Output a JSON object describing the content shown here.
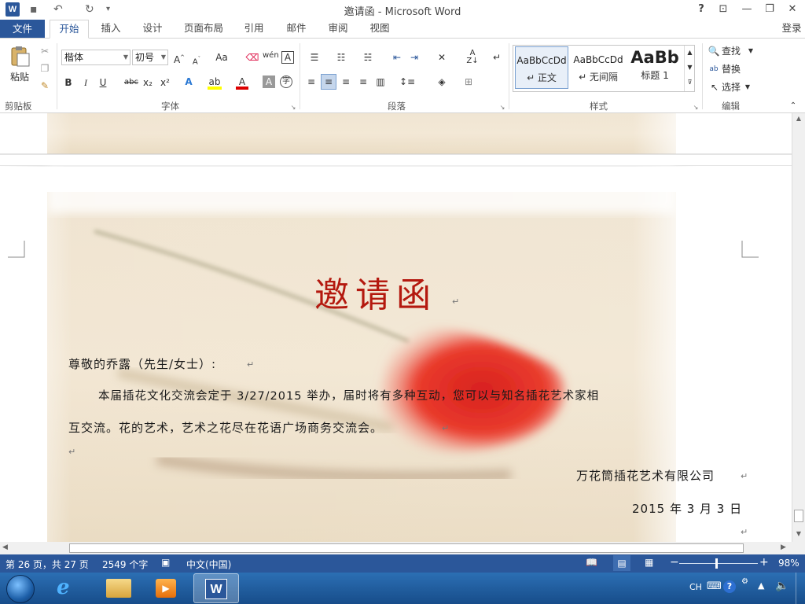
{
  "window": {
    "title": "邀请函 - Microsoft Word",
    "help": "?",
    "controls": [
      "⊡",
      "—",
      "❐",
      "✕"
    ]
  },
  "quick_access": {
    "save": "💾",
    "undo": "↶",
    "redo": "↻",
    "customize": "▾"
  },
  "tabs": [
    {
      "label": "文件"
    },
    {
      "label": "开始"
    },
    {
      "label": "插入"
    },
    {
      "label": "设计"
    },
    {
      "label": "页面布局"
    },
    {
      "label": "引用"
    },
    {
      "label": "邮件"
    },
    {
      "label": "审阅"
    },
    {
      "label": "视图"
    }
  ],
  "login": "登录",
  "ribbon": {
    "clipboard": {
      "paste": "粘贴",
      "label": "剪贴板"
    },
    "font": {
      "name": "楷体",
      "size": "初号",
      "label": "字体",
      "buttons": [
        "B",
        "I",
        "U",
        "abc",
        "x₂",
        "x²"
      ]
    },
    "paragraph": {
      "label": "段落"
    },
    "styles": {
      "label": "样式",
      "items": [
        {
          "sample": "AaBbCcDd",
          "name": "↵ 正文"
        },
        {
          "sample": "AaBbCcDd",
          "name": "↵ 无间隔"
        },
        {
          "sample": "AaBb",
          "name": "标题 1"
        }
      ]
    },
    "editing": {
      "label": "编辑",
      "find": "查找",
      "replace": "替换",
      "select": "选择"
    }
  },
  "document": {
    "title": "邀请函",
    "greeting": "尊敬的乔露（先生/女士）:",
    "body_line1": "本届插花文化交流会定于 3/27/2015 举办，届时将有多种互动，您可以与知名插花艺术家相",
    "body_line2": "互交流。花的艺术，艺术之花尽在花语广场商务交流会。",
    "company": "万花筒插花艺术有限公司",
    "date": "2015 年 3 月 3 日",
    "para_mark": "↵"
  },
  "status": {
    "page": "第 26 页，共 27 页",
    "words": "2549 个字",
    "language": "中文(中国)",
    "zoom": "98%"
  },
  "taskbar": {
    "tray_lang": "CH"
  }
}
